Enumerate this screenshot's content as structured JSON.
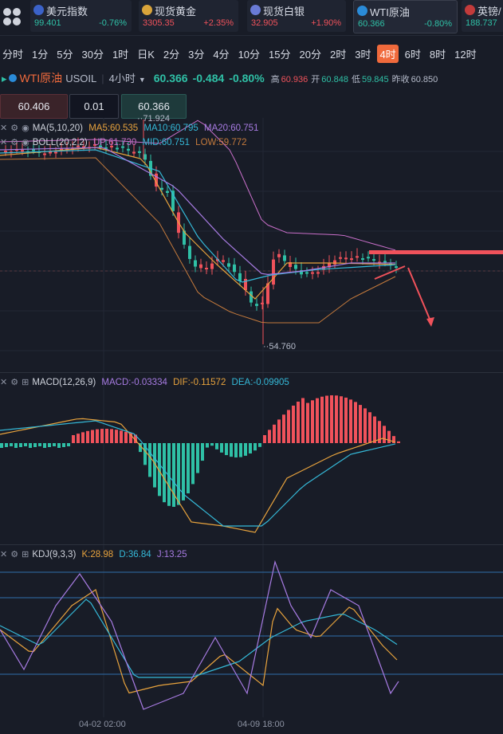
{
  "tickers": [
    {
      "name": "美元指数",
      "price": "99.401",
      "change": "-0.76%",
      "color": "#2fc0a6",
      "icon_color": "#3b62c9",
      "icon": "us-flag-icon"
    },
    {
      "name": "现货黄金",
      "price": "3305.35",
      "change": "+2.35%",
      "color": "#f0525b",
      "icon_color": "#d9a43a",
      "icon": "gold-icon"
    },
    {
      "name": "现货白银",
      "price": "32.905",
      "change": "+1.90%",
      "color": "#f0525b",
      "icon_color": "#6a7bd6",
      "icon": "silver-icon"
    },
    {
      "name": "WTI原油",
      "price": "60.366",
      "change": "-0.80%",
      "color": "#2fc0a6",
      "icon_color": "#2a8bd8",
      "icon": "oil-icon",
      "active": true
    },
    {
      "name": "英镑/",
      "price": "188.737",
      "change": "",
      "color": "#2fc0a6",
      "icon_color": "#c23b3b",
      "icon": "uk-flag-icon"
    }
  ],
  "periods": [
    "分时",
    "1分",
    "5分",
    "30分",
    "1时",
    "日K",
    "2分",
    "3分",
    "4分",
    "10分",
    "15分",
    "20分",
    "2时",
    "3时",
    "4时",
    "6时",
    "8时",
    "12时"
  ],
  "active_period": "4时",
  "symbol": {
    "name": "WTI原油",
    "code": "USOIL",
    "timeframe": "4小时",
    "price": "60.366",
    "change": "-0.484",
    "change_pct": "-0.80%",
    "high_label": "高",
    "high": "60.936",
    "open_label": "开",
    "open": "60.848",
    "low_label": "低",
    "low": "59.845",
    "prev_label": "昨收",
    "prev": "60.850"
  },
  "inputs": {
    "sell_price": "60.406",
    "lot": "0.01",
    "buy_price": "60.366"
  },
  "ma": {
    "label": "MA(5,10,20)",
    "ma5": "MA5:60.535",
    "ma10": "MA10:60.795",
    "ma20": "MA20:60.751"
  },
  "boll": {
    "label": "BOLL(20,2,2)",
    "up": "UP:61.730",
    "mid": "MID:60.751",
    "low": "LOW:59.772"
  },
  "main_chart": {
    "max_label": "71.924",
    "min_label": "54.760"
  },
  "macd": {
    "label": "MACD(12,26,9)",
    "macd": "MACD:-0.03334",
    "dif": "DIF:-0.11572",
    "dea": "DEA:-0.09905"
  },
  "kdj": {
    "label": "KDJ(9,3,3)",
    "k": "K:28.98",
    "d": "D:36.84",
    "j": "J:13.25"
  },
  "time_axis": [
    "04-02 02:00",
    "04-09 18:00"
  ],
  "colors": {
    "up": "#f0525b",
    "down": "#2fc0a6",
    "ma5": "#e8a33d",
    "ma10": "#35b9d8",
    "ma20": "#a77be2",
    "boll_up": "#c86fc9",
    "boll_low": "#c47a3c",
    "accent": "#f06a3c"
  }
}
